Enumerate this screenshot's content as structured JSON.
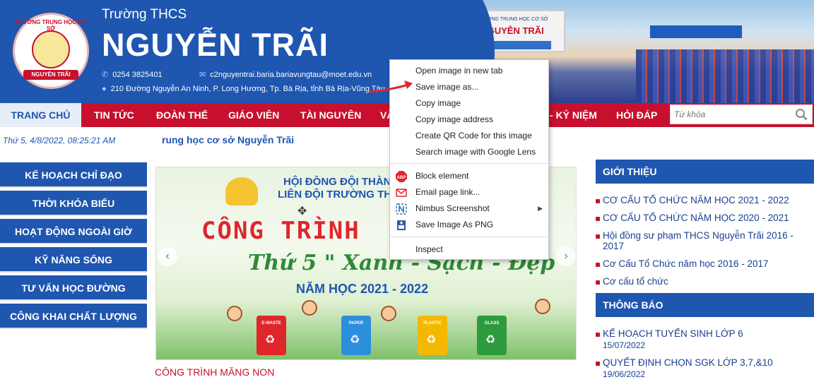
{
  "header": {
    "school_prefix": "Trường THCS",
    "school_name": "NGUYỄN TRÃI",
    "phone": "0254 3825401",
    "email": "c2nguyentrai.baria.bariavungtau@moet.edu.vn",
    "address": "210 Đường Nguyễn An Ninh, P. Long Hương, Tp. Bà Rịa, tỉnh Bà Rịa-Vũng Tàu",
    "logo_ring_text": "TRƯỜNG TRUNG HỌC CƠ SỞ",
    "logo_band_text": "NGUYỄN TRÃI",
    "photo_sign_top": "TRƯỜNG TRUNG HỌC CƠ SỞ",
    "photo_sign_name": "NGUYỄN TRÃI"
  },
  "nav": {
    "items": [
      "TRANG CHỦ",
      "TIN TỨC",
      "ĐOÀN THỂ",
      "GIÁO VIÊN",
      "TÀI NGUYÊN",
      "VĂ",
      "- KỶ NIỆM",
      "HỎI ĐÁP"
    ],
    "search_placeholder": "Từ khóa"
  },
  "ticker": {
    "datetime": "Thứ 5, 4/8/2022, 08:25:21 AM",
    "marquee": "rung học cơ sở Nguyễn Trãi"
  },
  "left_menu": [
    "KẾ HOẠCH CHỈ ĐẠO",
    "THỜI KHÓA BIỂU",
    "HOẠT ĐỘNG NGOÀI GIỜ",
    "KỸ NĂNG SỐNG",
    "TƯ VẤN HỌC ĐƯỜNG",
    "CÔNG KHAI CHẤT LƯỢNG"
  ],
  "slider": {
    "council_line1": "HỘI ĐỒNG ĐỘI THÀNH",
    "council_line2": "LIÊN ĐỘI TRƯỜNG THCS",
    "headline": "CÔNG TRÌNH",
    "subline": "Thứ 5 \" Xanh - Sạch - Đẹp",
    "year": "NĂM HỌC 2021 - 2022",
    "bins": [
      "E-WASTE",
      "PAPER",
      "PLASTIC",
      "GLASS"
    ],
    "caption": "CÔNG TRÌNH MĂNG NON",
    "prev_glyph": "‹",
    "next_glyph": "›"
  },
  "right": {
    "intro_title": "GIỚI THIỆU",
    "intro_items": [
      "CƠ CẤU TỔ CHỨC NĂM HỌC 2021 - 2022",
      "CƠ CẤU TỔ CHỨC NĂM HỌC 2020 - 2021",
      "Hội đồng sư phạm THCS Nguyễn Trãi 2016 - 2017",
      "Cơ Cấu Tổ Chức năm học 2016 - 2017",
      "Cơ cấu tổ chức"
    ],
    "notice_title": "THÔNG BÁO",
    "notices": [
      {
        "title": "KẾ HOẠCH TUYỂN SINH LỚP 6",
        "date": "15/07/2022"
      },
      {
        "title": "QUYẾT ĐỊNH CHỌN SGK LỚP 3,7,&10",
        "date": "19/06/2022"
      }
    ]
  },
  "context_menu": {
    "items": [
      {
        "label": "Open image in new tab",
        "icon": ""
      },
      {
        "label": "Save image as...",
        "icon": ""
      },
      {
        "label": "Copy image",
        "icon": ""
      },
      {
        "label": "Copy image address",
        "icon": ""
      },
      {
        "label": "Create QR Code for this image",
        "icon": ""
      },
      {
        "label": "Search image with Google Lens",
        "icon": ""
      },
      {
        "label": "Block element",
        "icon": "abp-icon"
      },
      {
        "label": "Email page link...",
        "icon": "email-icon"
      },
      {
        "label": "Nimbus Screenshot",
        "icon": "nimbus-icon"
      },
      {
        "label": "Save Image As PNG",
        "icon": "png-icon"
      },
      {
        "label": "Inspect",
        "icon": ""
      }
    ],
    "abp_text": "ABP"
  },
  "colors": {
    "brand_blue": "#1e56b0",
    "nav_red": "#c8102e"
  }
}
